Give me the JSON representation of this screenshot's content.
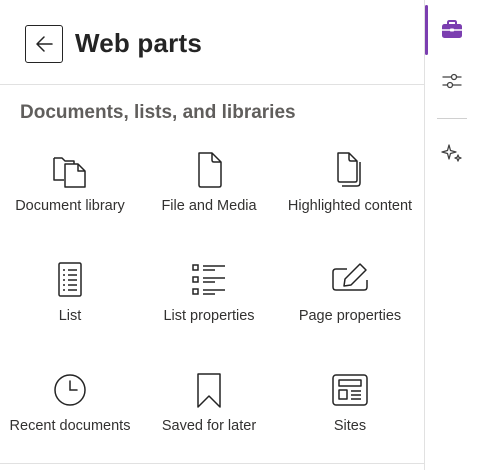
{
  "header": {
    "title": "Web parts",
    "back_icon": "back-arrow-icon"
  },
  "section": {
    "title": "Documents, lists, and libraries"
  },
  "tiles": [
    {
      "label": "Document library",
      "icon": "document-library-icon"
    },
    {
      "label": "File and Media",
      "icon": "file-icon"
    },
    {
      "label": "Highlighted content",
      "icon": "highlighted-content-icon"
    },
    {
      "label": "List",
      "icon": "list-icon"
    },
    {
      "label": "List properties",
      "icon": "list-properties-icon"
    },
    {
      "label": "Page properties",
      "icon": "page-properties-icon"
    },
    {
      "label": "Recent documents",
      "icon": "recent-documents-icon"
    },
    {
      "label": "Saved for later",
      "icon": "bookmark-icon"
    },
    {
      "label": "Sites",
      "icon": "sites-icon"
    }
  ],
  "rail": {
    "items": [
      {
        "icon": "toolbox-icon",
        "active": true
      },
      {
        "icon": "sliders-icon",
        "active": false
      },
      {
        "icon": "sparkle-icon",
        "active": false
      }
    ]
  },
  "colors": {
    "accent": "#7b3eb0",
    "text": "#242424",
    "section_title": "#605e5c",
    "divider": "#e1e1e1"
  }
}
